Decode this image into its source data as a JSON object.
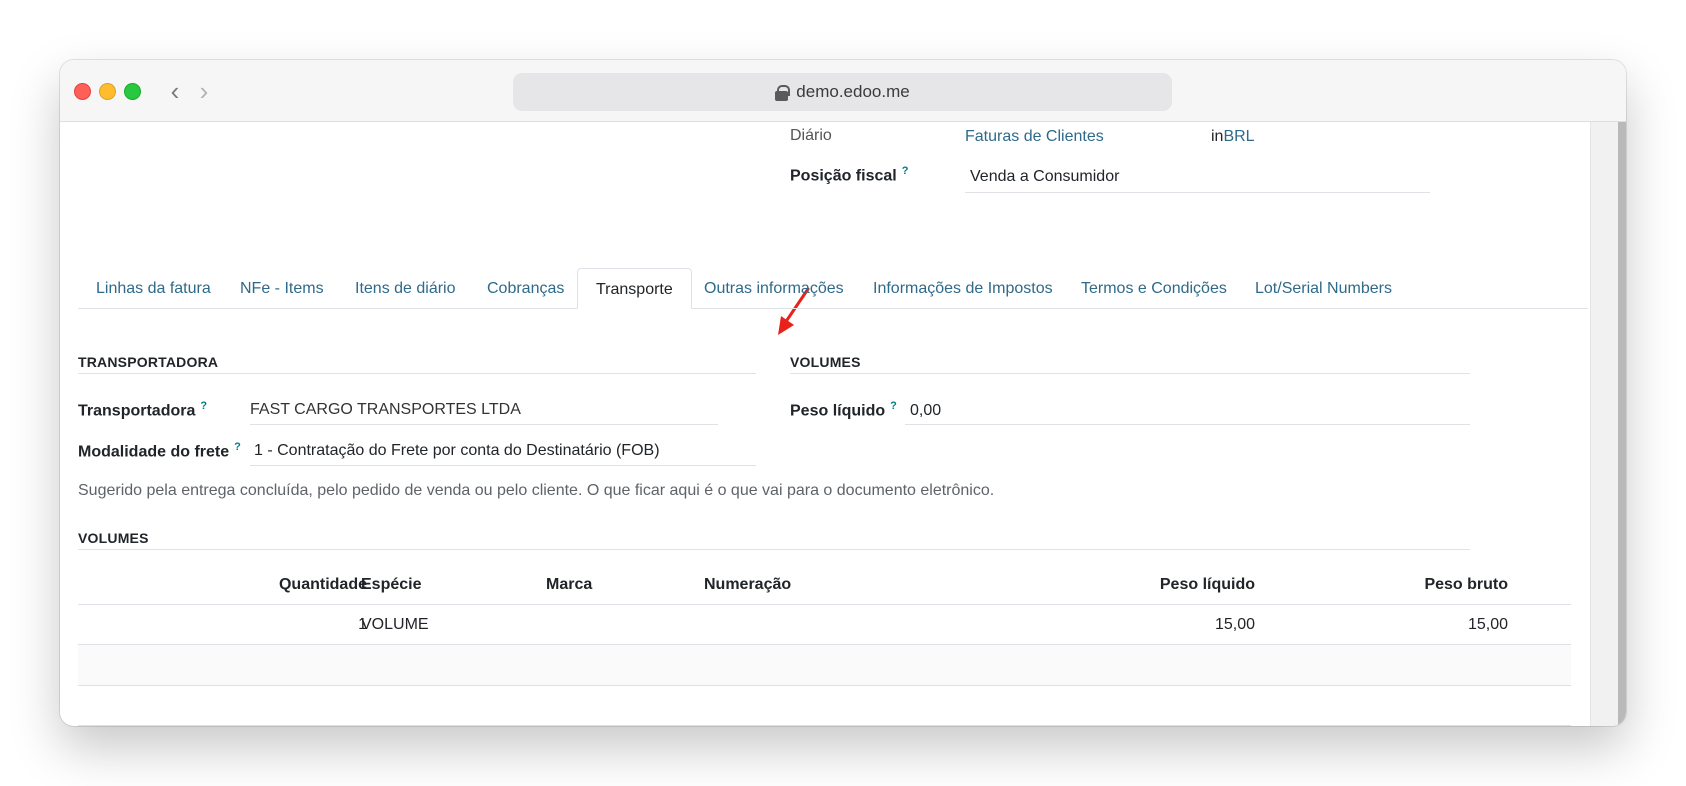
{
  "browser": {
    "url": "demo.edoo.me",
    "back_glyph": "‹",
    "forward_glyph": "›"
  },
  "header_fields": {
    "diario_label": "Diário",
    "diario_value": "Faturas de Clientes",
    "currency_prefix": "in",
    "currency_value": "BRL",
    "posicao_label": "Posição fiscal",
    "posicao_value": "Venda a Consumidor",
    "tooltip_marker": "?"
  },
  "tabs": [
    {
      "label": "Linhas da fatura"
    },
    {
      "label": "NFe - Items"
    },
    {
      "label": "Itens de diário"
    },
    {
      "label": "Cobranças"
    },
    {
      "label": "Transporte"
    },
    {
      "label": "Outras informações"
    },
    {
      "label": "Informações de Impostos"
    },
    {
      "label": "Termos e Condições"
    },
    {
      "label": "Lot/Serial Numbers"
    }
  ],
  "active_tab": "Transporte",
  "transportadora_section": {
    "title": "TRANSPORTADORA",
    "transportadora_label": "Transportadora",
    "transportadora_value": "FAST CARGO TRANSPORTES LTDA",
    "modalidade_label": "Modalidade do frete",
    "modalidade_value": "1 - Contratação do Frete por conta do Destinatário (FOB)"
  },
  "volumes_summary": {
    "title": "VOLUMES",
    "peso_label": "Peso líquido",
    "peso_value": "0,00"
  },
  "help_text": "Sugerido pela entrega concluída, pelo pedido de venda ou pelo cliente. O que ficar aqui é o que vai para o documento eletrônico.",
  "volumes_table": {
    "title": "VOLUMES",
    "columns": [
      "Quantidade",
      "Espécie",
      "Marca",
      "Numeração",
      "Peso líquido",
      "Peso bruto"
    ],
    "rows": [
      [
        "1",
        "VOLUME",
        "",
        "",
        "15,00",
        "15,00"
      ]
    ]
  },
  "colors": {
    "link": "#2f6a8a",
    "annotation_arrow": "#e8221b",
    "tooltip": "#017e84"
  }
}
